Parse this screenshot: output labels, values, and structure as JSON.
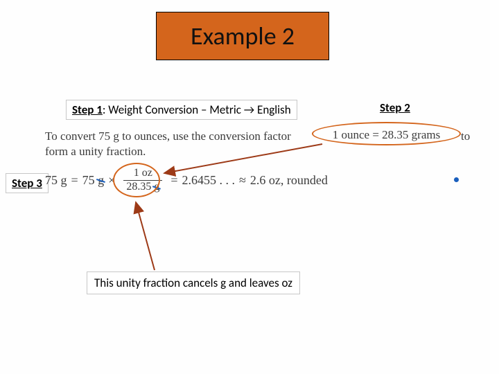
{
  "title": "Example 2",
  "step1": {
    "label": "Step 1",
    "text": ": Weight Conversion – Metric → English"
  },
  "step2": "Step 2",
  "step3": "Step 3",
  "body": {
    "line1a": "To convert 75 g to ounces, use the conversion factor",
    "factor": "1 ounce  =  28.35 grams",
    "line1b": "to",
    "line2": "form a unity fraction."
  },
  "equation": {
    "lhs": "75 g",
    "eq1": "=",
    "mid_val": "75",
    "mid_unit": "g",
    "times": "×",
    "frac_num": "1 oz",
    "frac_den_val": "28.35",
    "frac_den_unit": "g",
    "eq2": "=",
    "decimal": "2.6455 . . .",
    "approx": "≈",
    "result": "2.6 oz, rounded"
  },
  "caption": "This unity fraction cancels g and leaves oz"
}
